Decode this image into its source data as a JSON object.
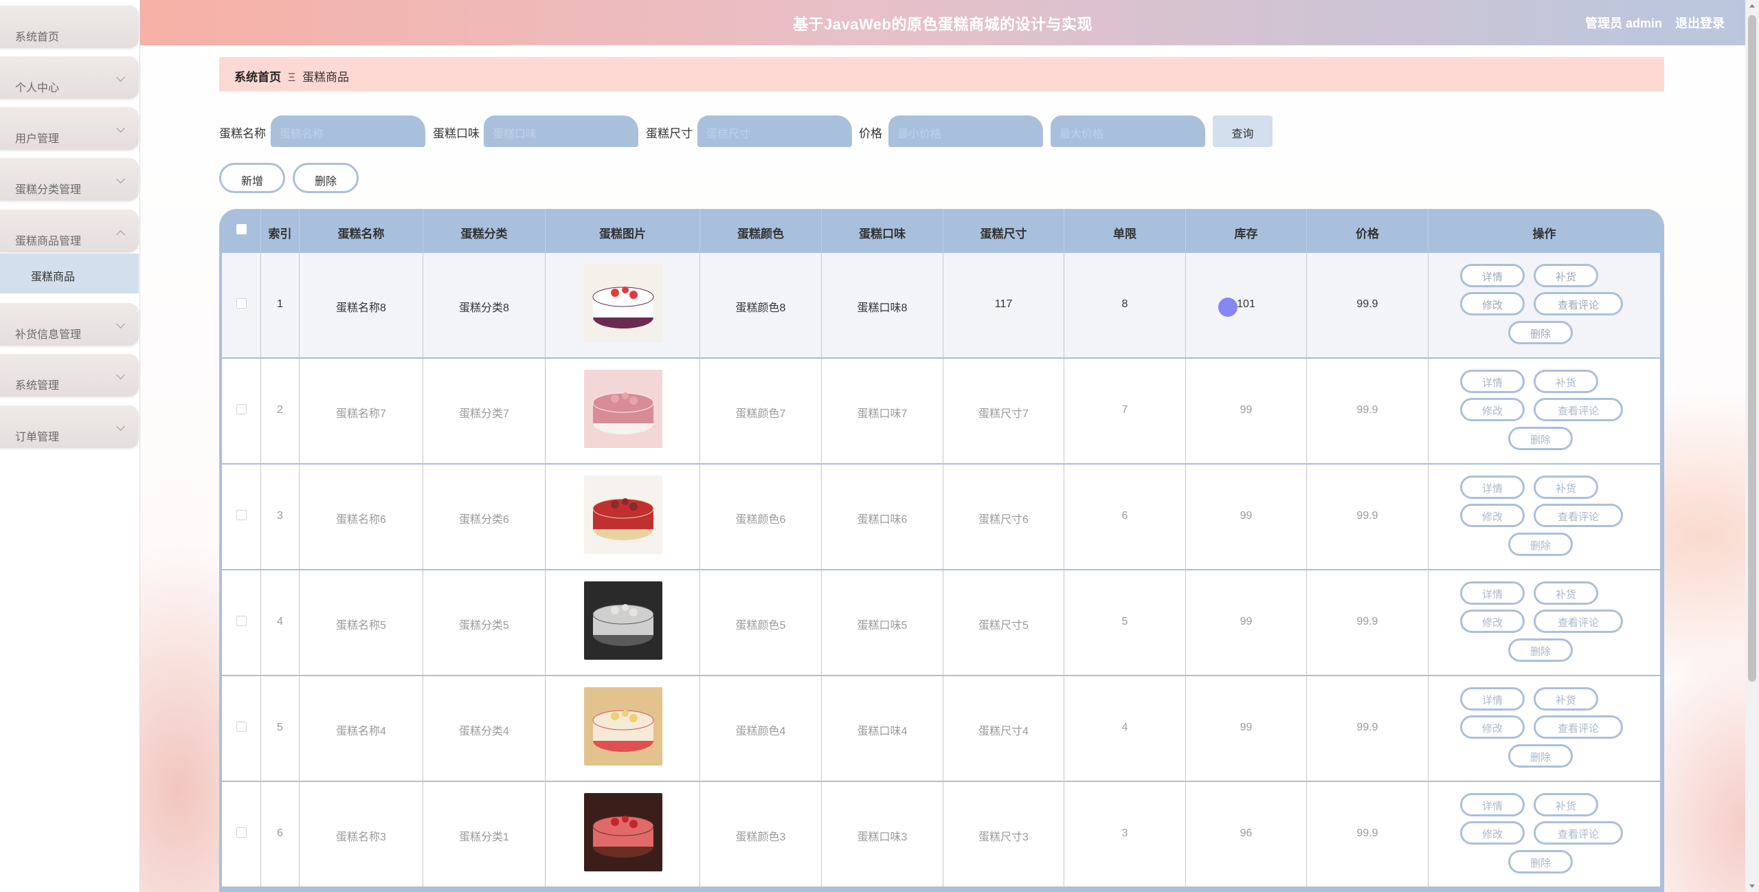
{
  "header": {
    "title": "基于JavaWeb的原色蛋糕商城的设计与实现",
    "user": "管理员 admin",
    "logout": "退出登录"
  },
  "sidebar": {
    "items": [
      {
        "label": "系统首页"
      },
      {
        "label": "个人中心"
      },
      {
        "label": "用户管理"
      },
      {
        "label": "蛋糕分类管理"
      },
      {
        "label": "蛋糕商品管理"
      },
      {
        "label": "补货信息管理"
      },
      {
        "label": "系统管理"
      },
      {
        "label": "订单管理"
      }
    ],
    "active_sub": "蛋糕商品"
  },
  "breadcrumb": {
    "home": "系统首页",
    "sep": "Ξ",
    "current": "蛋糕商品"
  },
  "search": {
    "name_label": "蛋糕名称",
    "name_placeholder": "蛋糕名称",
    "taste_label": "蛋糕口味",
    "taste_placeholder": "蛋糕口味",
    "size_label": "蛋糕尺寸",
    "size_placeholder": "蛋糕尺寸",
    "price_label": "价格",
    "min_price_placeholder": "最小价格",
    "max_price_placeholder": "最大价格",
    "query_button": "查询"
  },
  "actions": {
    "add": "新增",
    "delete": "删除"
  },
  "table": {
    "headers": [
      "索引",
      "蛋糕名称",
      "蛋糕分类",
      "蛋糕图片",
      "蛋糕颜色",
      "蛋糕口味",
      "蛋糕尺寸",
      "单限",
      "库存",
      "价格",
      "操作"
    ],
    "ops": {
      "detail": "详情",
      "restock": "补货",
      "edit": "修改",
      "reviews": "查看评论",
      "delete": "删除"
    },
    "rows": [
      {
        "index": "1",
        "name": "蛋糕名称8",
        "category": "蛋糕分类8",
        "color": "蛋糕颜色8",
        "taste": "蛋糕口味8",
        "size": "117",
        "limit": "8",
        "stock": "101",
        "price": "99.9"
      },
      {
        "index": "2",
        "name": "蛋糕名称7",
        "category": "蛋糕分类7",
        "color": "蛋糕颜色7",
        "taste": "蛋糕口味7",
        "size": "蛋糕尺寸7",
        "limit": "7",
        "stock": "99",
        "price": "99.9"
      },
      {
        "index": "3",
        "name": "蛋糕名称6",
        "category": "蛋糕分类6",
        "color": "蛋糕颜色6",
        "taste": "蛋糕口味6",
        "size": "蛋糕尺寸6",
        "limit": "6",
        "stock": "99",
        "price": "99.9"
      },
      {
        "index": "4",
        "name": "蛋糕名称5",
        "category": "蛋糕分类5",
        "color": "蛋糕颜色5",
        "taste": "蛋糕口味5",
        "size": "蛋糕尺寸5",
        "limit": "5",
        "stock": "99",
        "price": "99.9"
      },
      {
        "index": "5",
        "name": "蛋糕名称4",
        "category": "蛋糕分类4",
        "color": "蛋糕颜色4",
        "taste": "蛋糕口味4",
        "size": "蛋糕尺寸4",
        "limit": "4",
        "stock": "99",
        "price": "99.9"
      },
      {
        "index": "6",
        "name": "蛋糕名称3",
        "category": "蛋糕分类1",
        "color": "蛋糕颜色3",
        "taste": "蛋糕口味3",
        "size": "蛋糕尺寸3",
        "limit": "3",
        "stock": "96",
        "price": "99.9"
      }
    ]
  },
  "colors": {
    "accent": "#a9c0dc",
    "header_left": "#f7b1a6",
    "header_right": "#b9c7de",
    "breadcrumb_bg": "#fdd9d3"
  }
}
